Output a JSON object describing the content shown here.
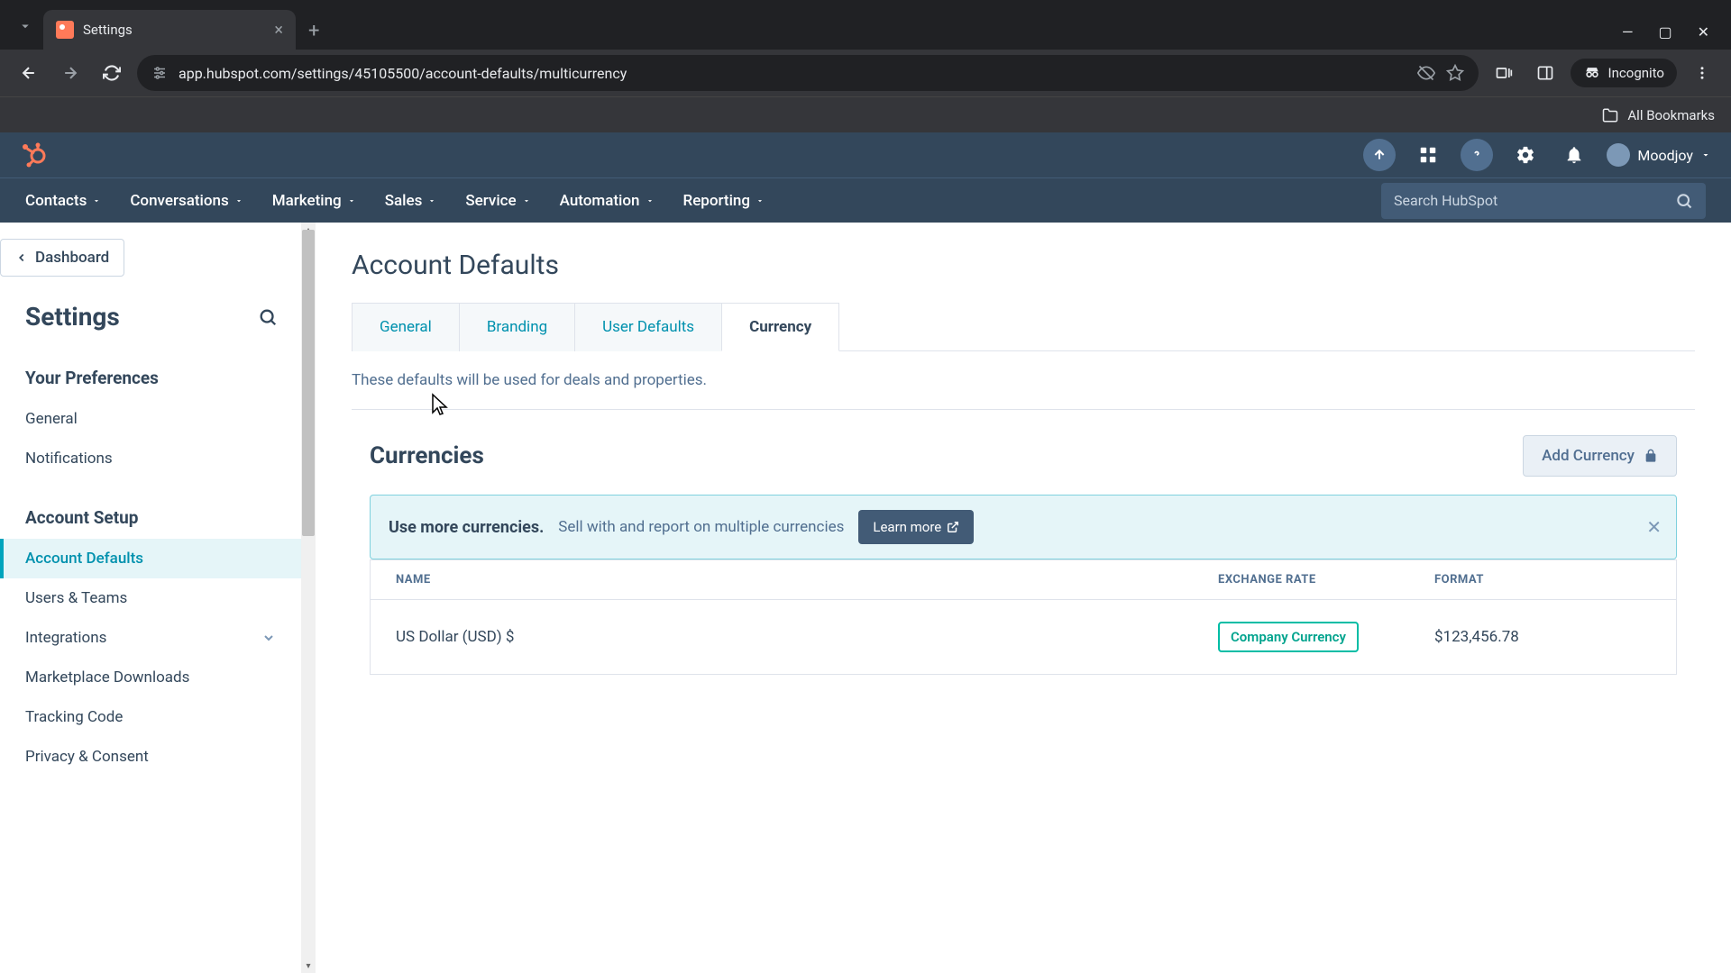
{
  "browser": {
    "tab_title": "Settings",
    "url": "app.hubspot.com/settings/45105500/account-defaults/multicurrency",
    "incognito_label": "Incognito",
    "bookmarks_label": "All Bookmarks"
  },
  "header": {
    "user_name": "Moodjoy"
  },
  "nav": {
    "items": [
      "Contacts",
      "Conversations",
      "Marketing",
      "Sales",
      "Service",
      "Automation",
      "Reporting"
    ],
    "search_placeholder": "Search HubSpot"
  },
  "sidebar": {
    "dashboard_label": "Dashboard",
    "title": "Settings",
    "sections": [
      {
        "label": "Your Preferences",
        "items": [
          {
            "label": "General",
            "active": false
          },
          {
            "label": "Notifications",
            "active": false
          }
        ]
      },
      {
        "label": "Account Setup",
        "items": [
          {
            "label": "Account Defaults",
            "active": true
          },
          {
            "label": "Users & Teams",
            "active": false
          },
          {
            "label": "Integrations",
            "active": false,
            "expandable": true
          },
          {
            "label": "Marketplace Downloads",
            "active": false
          },
          {
            "label": "Tracking Code",
            "active": false
          },
          {
            "label": "Privacy & Consent",
            "active": false
          }
        ]
      }
    ]
  },
  "main": {
    "title": "Account Defaults",
    "tabs": [
      {
        "label": "General",
        "active": false
      },
      {
        "label": "Branding",
        "active": false
      },
      {
        "label": "User Defaults",
        "active": false
      },
      {
        "label": "Currency",
        "active": true
      }
    ],
    "description": "These defaults will be used for deals and properties.",
    "currencies": {
      "heading": "Currencies",
      "add_button": "Add Currency",
      "banner": {
        "title": "Use more currencies.",
        "text": "Sell with and report on multiple currencies",
        "cta": "Learn more"
      },
      "table": {
        "headers": {
          "name": "NAME",
          "rate": "EXCHANGE RATE",
          "format": "FORMAT"
        },
        "rows": [
          {
            "name": "US Dollar (USD) $",
            "badge": "Company Currency",
            "format": "$123,456.78"
          }
        ]
      }
    }
  }
}
